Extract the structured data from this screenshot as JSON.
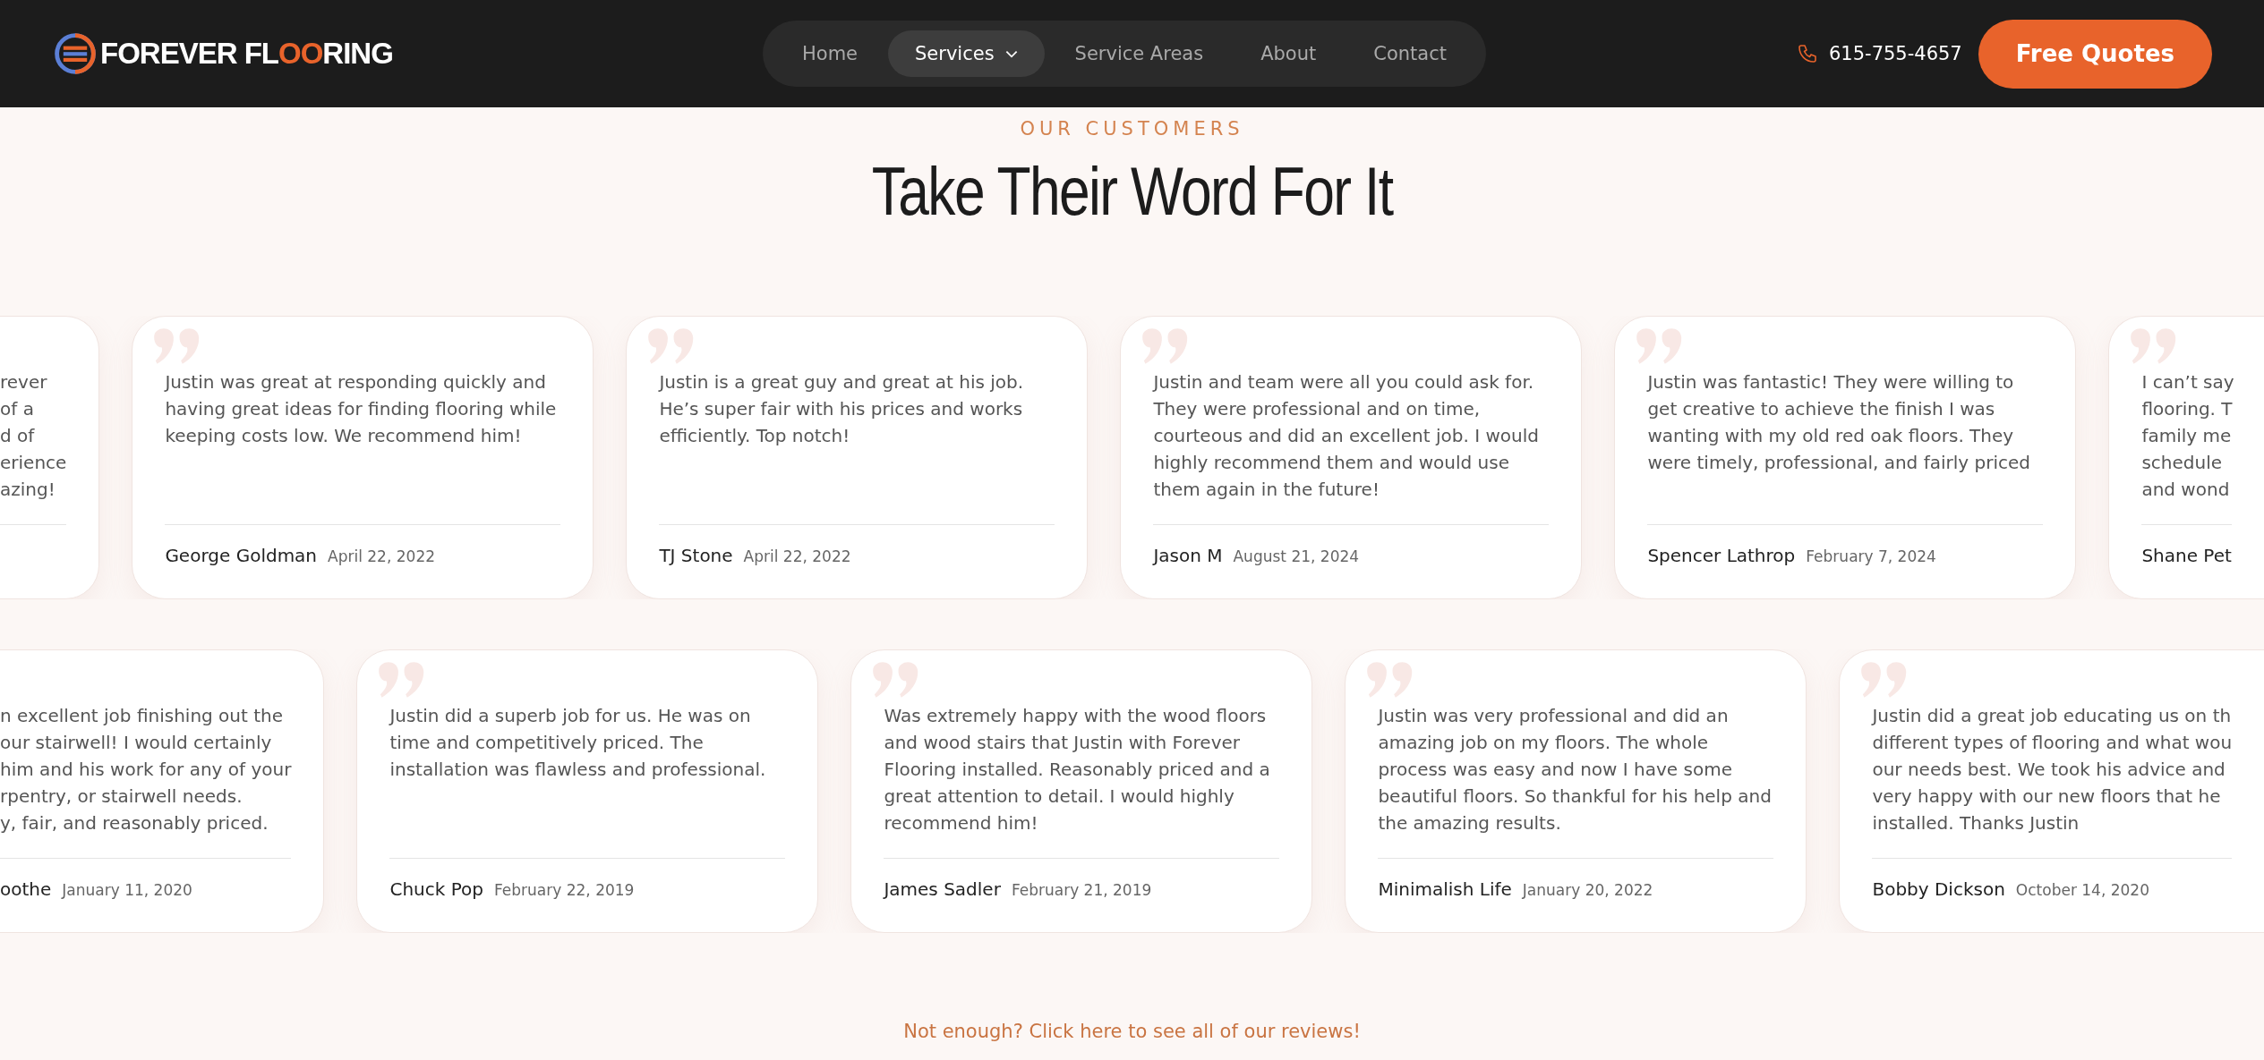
{
  "header": {
    "logo_parts": [
      {
        "text": "FOREVER FL",
        "accent": false
      },
      {
        "text": "OO",
        "accent": true
      },
      {
        "text": "RING",
        "accent": false
      }
    ],
    "nav": [
      {
        "label": "Home",
        "selected": false,
        "dropdown": false
      },
      {
        "label": "Services",
        "selected": true,
        "dropdown": true
      },
      {
        "label": "Service Areas",
        "selected": false,
        "dropdown": false
      },
      {
        "label": "About",
        "selected": false,
        "dropdown": false
      },
      {
        "label": "Contact",
        "selected": false,
        "dropdown": false
      }
    ],
    "phone": "615-755-4657",
    "cta": "Free Quotes"
  },
  "section": {
    "eyebrow": "OUR CUSTOMERS",
    "title": "Take Their Word For It"
  },
  "review_rows": [
    [
      {
        "kind": "cut_left",
        "lines": [
          "rever",
          "of a",
          "d of",
          "erience",
          "azing!"
        ]
      },
      {
        "kind": "full",
        "text": "Justin was great at responding quickly and having great ideas for finding flooring while keeping costs low. We recommend him!",
        "author": "George Goldman",
        "date": "April 22, 2022"
      },
      {
        "kind": "full",
        "text": "Justin is a great guy and great at his job. He’s super fair with his prices and works efficiently. Top notch!",
        "author": "TJ Stone",
        "date": "April 22, 2022"
      },
      {
        "kind": "full",
        "text": "Justin and team were all you could ask for. They were professional and on time, courteous and did an excellent job. I would highly recommend them and would use them again in the future!",
        "author": "Jason M",
        "date": "August 21, 2024"
      },
      {
        "kind": "full",
        "text": "Justin was fantastic! They were willing to get creative to achieve the finish I was wanting with my old red oak floors. They were timely, professional, and fairly priced",
        "author": "Spencer Lathrop",
        "date": "February 7, 2024"
      },
      {
        "kind": "cut_right",
        "lines": [
          "I can’t say",
          "flooring. T",
          "family me",
          "schedule",
          "and wond"
        ],
        "author": "Shane Pet"
      }
    ],
    [
      {
        "kind": "cut_left",
        "lines": [
          "n excellent job finishing out the",
          "our stairwell! I would certainly",
          "him and his work for any of your",
          "rpentry, or stairwell needs.",
          "y, fair, and reasonably priced."
        ],
        "author": "oothe",
        "date": "January 11, 2020"
      },
      {
        "kind": "full",
        "text": "Justin did a superb job for us. He was on time and competitively priced. The installation was flawless and professional.",
        "author": "Chuck Pop",
        "date": "February 22, 2019"
      },
      {
        "kind": "full",
        "text": "Was extremely happy with the wood floors and wood stairs that Justin with Forever Flooring installed. Reasonably priced and a great attention to detail. I would highly recommend him!",
        "author": "James Sadler",
        "date": "February 21, 2019"
      },
      {
        "kind": "full",
        "text": "Justin was very professional and did an amazing job on my floors. The whole process was easy and now I have some beautiful floors. So thankful for his help and the amazing results.",
        "author": "Minimalish Life",
        "date": "January 20, 2022"
      },
      {
        "kind": "cut_right",
        "lines": [
          "Justin did a great job educating us on th",
          "different types of flooring and what wou",
          "our needs best. We took his advice and",
          "very happy with our new floors that he",
          "installed. Thanks Justin"
        ],
        "author": "Bobby Dickson",
        "date": "October 14, 2020"
      }
    ]
  ],
  "more_link": "Not enough? Click here to see all of our reviews!"
}
